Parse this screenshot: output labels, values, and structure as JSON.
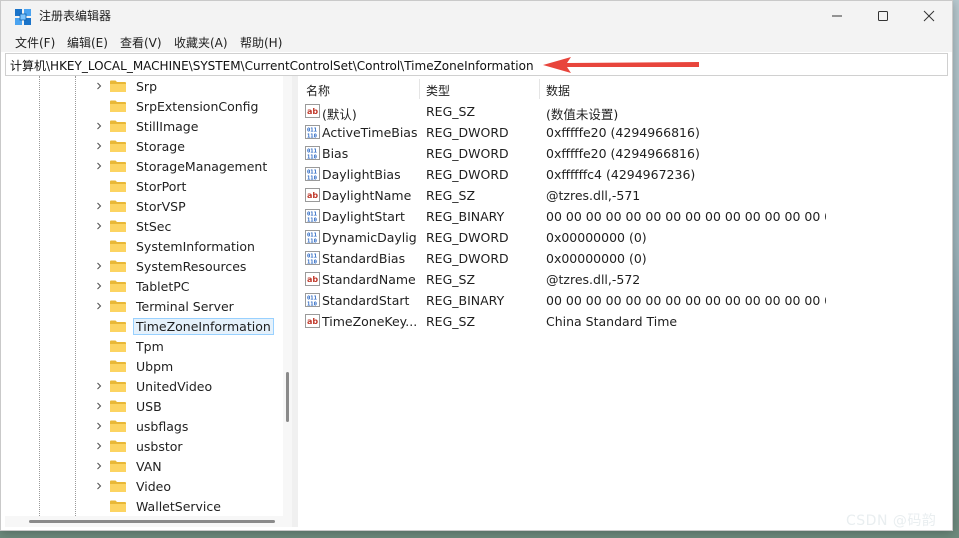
{
  "window": {
    "title": "注册表编辑器",
    "app_icon": "regedit-icon",
    "controls": [
      "minimize-icon",
      "maximize-icon",
      "close-icon"
    ]
  },
  "menu": {
    "items": [
      "文件(F)",
      "编辑(E)",
      "查看(V)",
      "收藏夹(A)",
      "帮助(H)"
    ]
  },
  "address": {
    "path": "计算机\\HKEY_LOCAL_MACHINE\\SYSTEM\\CurrentControlSet\\Control\\TimeZoneInformation",
    "annotation_arrow_color": "#e8453c"
  },
  "tree": {
    "items": [
      {
        "label": "Srp",
        "expandable": true
      },
      {
        "label": "SrpExtensionConfig",
        "expandable": false
      },
      {
        "label": "StillImage",
        "expandable": true
      },
      {
        "label": "Storage",
        "expandable": true
      },
      {
        "label": "StorageManagement",
        "expandable": true
      },
      {
        "label": "StorPort",
        "expandable": false
      },
      {
        "label": "StorVSP",
        "expandable": true
      },
      {
        "label": "StSec",
        "expandable": true
      },
      {
        "label": "SystemInformation",
        "expandable": false
      },
      {
        "label": "SystemResources",
        "expandable": true
      },
      {
        "label": "TabletPC",
        "expandable": true
      },
      {
        "label": "Terminal Server",
        "expandable": true
      },
      {
        "label": "TimeZoneInformation",
        "expandable": false,
        "selected": true
      },
      {
        "label": "Tpm",
        "expandable": false
      },
      {
        "label": "Ubpm",
        "expandable": false
      },
      {
        "label": "UnitedVideo",
        "expandable": true
      },
      {
        "label": "USB",
        "expandable": true
      },
      {
        "label": "usbflags",
        "expandable": true
      },
      {
        "label": "usbstor",
        "expandable": true
      },
      {
        "label": "VAN",
        "expandable": true
      },
      {
        "label": "Video",
        "expandable": true
      },
      {
        "label": "WalletService",
        "expandable": false
      }
    ]
  },
  "list": {
    "columns": {
      "name": "名称",
      "type": "类型",
      "data": "数据"
    },
    "rows": [
      {
        "icon": "string-value-icon",
        "name": "(默认)",
        "type": "REG_SZ",
        "data": "(数值未设置)"
      },
      {
        "icon": "binary-value-icon",
        "name": "ActiveTimeBias",
        "type": "REG_DWORD",
        "data": "0xfffffe20 (4294966816)"
      },
      {
        "icon": "binary-value-icon",
        "name": "Bias",
        "type": "REG_DWORD",
        "data": "0xfffffe20 (4294966816)"
      },
      {
        "icon": "binary-value-icon",
        "name": "DaylightBias",
        "type": "REG_DWORD",
        "data": "0xffffffc4 (4294967236)"
      },
      {
        "icon": "string-value-icon",
        "name": "DaylightName",
        "type": "REG_SZ",
        "data": "@tzres.dll,-571"
      },
      {
        "icon": "binary-value-icon",
        "name": "DaylightStart",
        "type": "REG_BINARY",
        "data": "00 00 00 00 00 00 00 00 00 00 00 00 00 00 00 00..."
      },
      {
        "icon": "binary-value-icon",
        "name": "DynamicDaylig...",
        "type": "REG_DWORD",
        "data": "0x00000000 (0)"
      },
      {
        "icon": "binary-value-icon",
        "name": "StandardBias",
        "type": "REG_DWORD",
        "data": "0x00000000 (0)"
      },
      {
        "icon": "string-value-icon",
        "name": "StandardName",
        "type": "REG_SZ",
        "data": "@tzres.dll,-572"
      },
      {
        "icon": "binary-value-icon",
        "name": "StandardStart",
        "type": "REG_BINARY",
        "data": "00 00 00 00 00 00 00 00 00 00 00 00 00 00 00 00..."
      },
      {
        "icon": "string-value-icon",
        "name": "TimeZoneKey...",
        "type": "REG_SZ",
        "data": "China Standard Time"
      }
    ]
  },
  "watermark": "CSDN @码韵"
}
